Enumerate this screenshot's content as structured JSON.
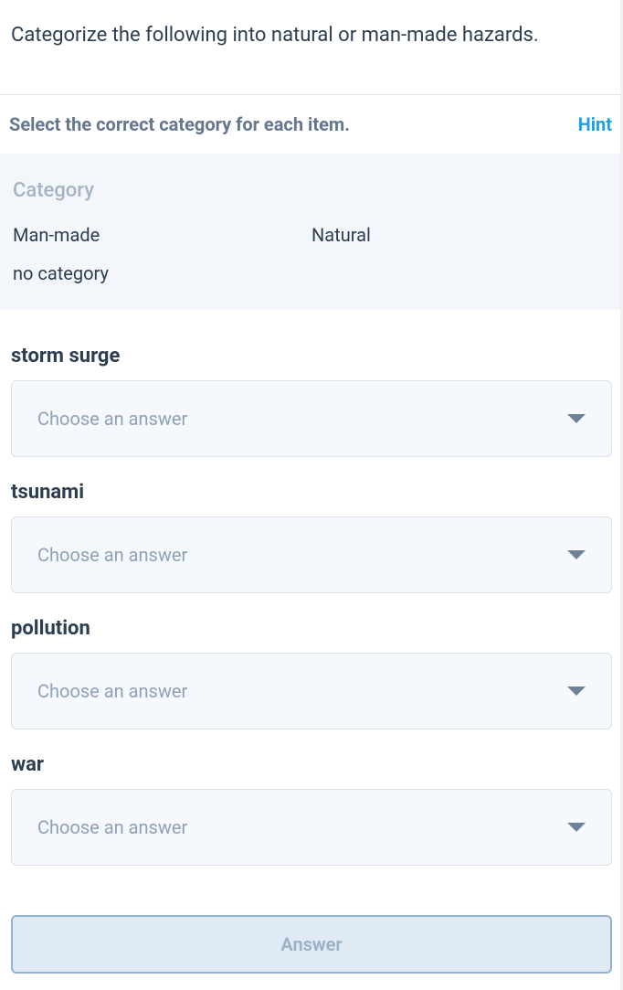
{
  "question": "Categorize the following into natural or man-made hazards.",
  "instruction": "Select the correct category for each item.",
  "hint_label": "Hint",
  "category_header": "Category",
  "categories": [
    "Man-made",
    "Natural",
    "no category"
  ],
  "dropdown_placeholder": "Choose an answer",
  "items": [
    {
      "label": "storm surge"
    },
    {
      "label": "tsunami"
    },
    {
      "label": "pollution"
    },
    {
      "label": "war"
    }
  ],
  "answer_button": "Answer"
}
